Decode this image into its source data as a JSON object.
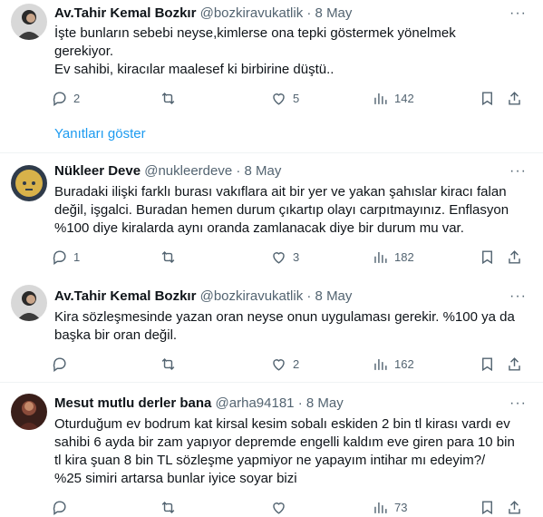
{
  "tweets": [
    {
      "name": "Av.Tahir Kemal Bozkır",
      "handle": "@bozkiravukatlik",
      "date": "· 8 May",
      "lines": [
        "İşte bunların sebebi neyse,kimlerse ona tepki göstermek yönelmek",
        "gerekiyor.",
        "Ev sahibi, kiracılar maalesef ki birbirine düştü.."
      ],
      "replies": "2",
      "retweets": "",
      "likes": "5",
      "views": "142"
    },
    {
      "name": "Nükleer Deve",
      "handle": "@nukleerdeve",
      "date": "· 8 May",
      "lines": [
        "Buradaki ilişki farklı burası vakıflara ait bir yer ve yakan şahıslar kiracı falan",
        "değil, işgalci. Buradan hemen durum çıkartıp olayı carpıtmayınız. Enflasyon",
        "%100 diye kiralarda  aynı oranda zamlanacak diye bir durum mu var."
      ],
      "replies": "1",
      "retweets": "",
      "likes": "3",
      "views": "182"
    },
    {
      "name": "Av.Tahir Kemal Bozkır",
      "handle": "@bozkiravukatlik",
      "date": "· 8 May",
      "lines": [
        "Kira sözleşmesinde yazan oran neyse onun uygulaması gerekir. %100 ya da",
        "başka bir oran değil."
      ],
      "replies": "",
      "retweets": "",
      "likes": "2",
      "views": "162"
    },
    {
      "name": "Mesut mutlu derler bana",
      "handle": "@arha94181",
      "date": "· 8 May",
      "lines": [
        "Oturduğum ev bodrum kat kirsal kesim sobalı eskiden 2 bin tl kirası vardı ev",
        "sahibi 6 ayda bir zam yapıyor depremde engelli kaldım eve giren para 10 bin",
        "tl kira şuan 8 bin TL  sözleşme yapmiyor ne yapayım intihar mı edeyim?/",
        "%25 simiri artarsa bunlar iyice soyar bizi"
      ],
      "replies": "",
      "retweets": "",
      "likes": "",
      "views": "73"
    }
  ],
  "show_replies": "Yanıtları göster",
  "more_label": "···"
}
